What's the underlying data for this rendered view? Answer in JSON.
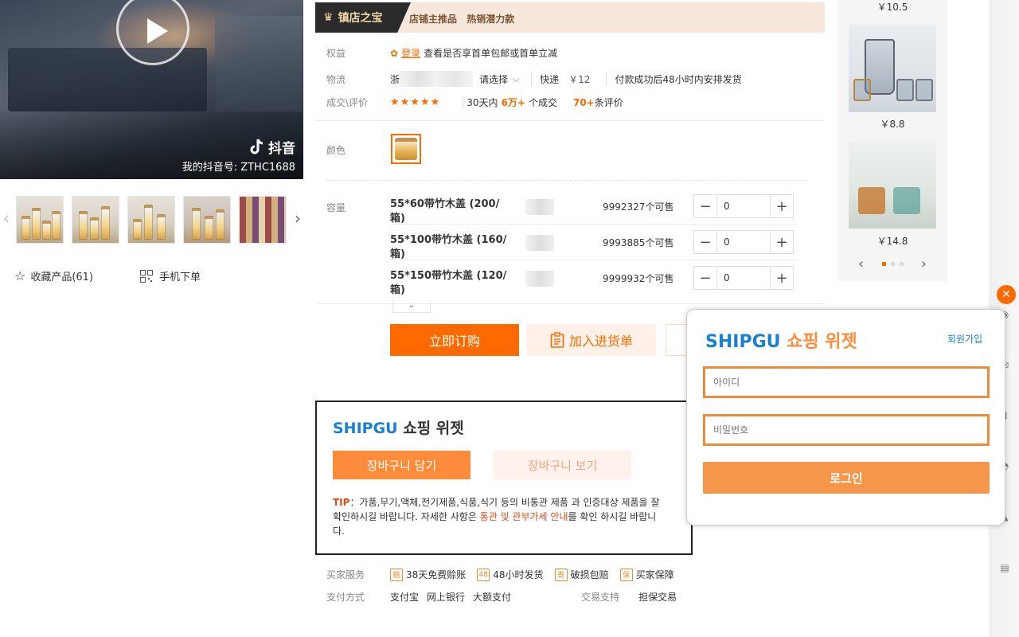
{
  "video": {
    "platform": "抖音",
    "account_id": "我的抖音号: ZTHC1688"
  },
  "thumbnails": {
    "prev": "‹",
    "next": "›",
    "count": 5
  },
  "actions": {
    "favorite": "收藏产品(61)",
    "mobile_order": "手机下单"
  },
  "banner": {
    "badge": "镇店之宝",
    "tags": [
      "店铺主推品",
      "热销潜力款"
    ]
  },
  "info": {
    "benefit_label": "权益",
    "benefit_login": "登录",
    "benefit_text": "查看是否享首单包邮或首单立减",
    "logistics_label": "物流",
    "logistics_from": "浙",
    "logistics_select": "请选择",
    "logistics_method": "快递",
    "logistics_price": "￥12",
    "logistics_note": "付款成功后48小时内安排发货",
    "deals_label": "成交\\评价",
    "stars": "★★★★★",
    "deals_prefix": "30天内",
    "deals_count": "6万+",
    "deals_suffix": "个成交",
    "reviews_count": "70+",
    "reviews_suffix": "条评价"
  },
  "color": {
    "label": "颜色"
  },
  "capacity": {
    "label": "容量",
    "rows": [
      {
        "name": "55*60带竹木盖 (200/箱)",
        "stock": "9992327个可售",
        "qty": "0"
      },
      {
        "name": "55*100带竹木盖 (160/箱)",
        "stock": "9993885个可售",
        "qty": "0"
      },
      {
        "name": "55*150带竹木盖 (120/箱)",
        "stock": "9999932个可售",
        "qty": "0"
      }
    ],
    "minus": "−",
    "plus": "+",
    "expand": "⌄"
  },
  "buttons": {
    "buy": "立即订购",
    "add_cart": "加入进货单"
  },
  "shipgu_inline": {
    "brand": "SHIPGU",
    "title_rest": " 쇼핑 위젯",
    "add_cart": "장바구니 담기",
    "view_cart": "장바구니 보기",
    "tip_label": "TIP",
    "tip_text1": "：가품,무기,액체,전기제품,식품,식기 등의 비통관 제품 과 인증대상 제품을 잘 확인하시길 바랍니다. 자세한 사항은 ",
    "tip_link": "통관 및 관부가세 안내",
    "tip_text2": "를 확인 하시길 바랍니다."
  },
  "services": {
    "buyer_label": "买家服务",
    "items": [
      {
        "icon": "赔",
        "text": "38天免费赊账"
      },
      {
        "icon": "48",
        "text": "48小时发货"
      },
      {
        "icon": "寄",
        "text": "破损包赔"
      },
      {
        "icon": "保",
        "text": "买家保障"
      }
    ],
    "payment_label": "支付方式",
    "payments": [
      "支付宝",
      "网上银行",
      "大额支付"
    ],
    "trade_label": "交易支持",
    "trade_value": "担保交易"
  },
  "recommendations": {
    "prices": [
      "￥10.5",
      "￥8.8",
      "￥14.8"
    ],
    "prev": "‹",
    "next": "›"
  },
  "login_widget": {
    "brand": "SHIPGU",
    "title_rest": " 쇼핑 위젯",
    "signup": "회원가입",
    "id_placeholder": "아이디",
    "pw_placeholder": "비밀번호",
    "login": "로그인",
    "close": "✕"
  },
  "colors": {
    "accent": "#ff6a00",
    "brand_blue": "#1a7fd0",
    "shipgu_orange": "#ff8c3a"
  }
}
